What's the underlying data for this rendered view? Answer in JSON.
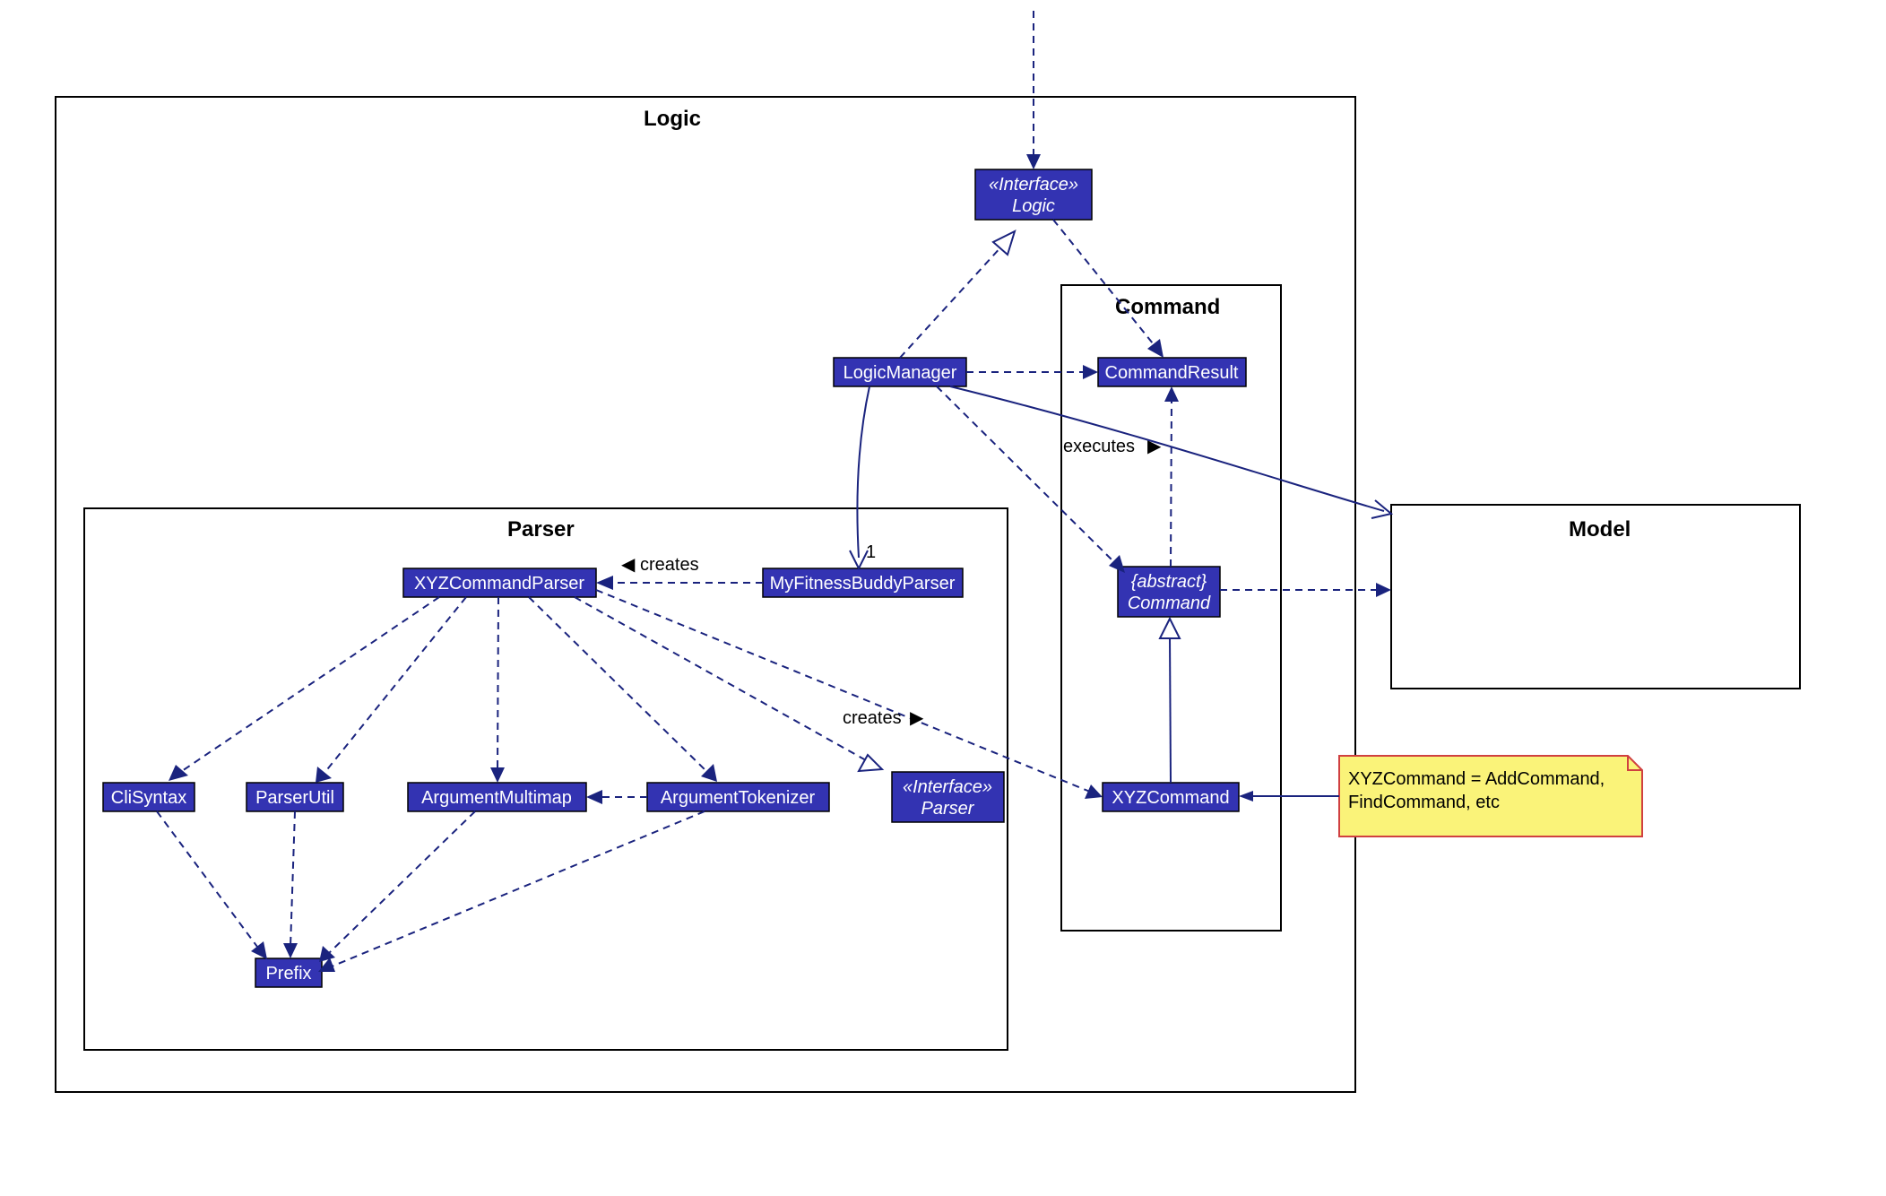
{
  "packages": {
    "logic": "Logic",
    "parser": "Parser",
    "command": "Command",
    "model": "Model"
  },
  "nodes": {
    "logicInterface": {
      "stereotype": "«Interface»",
      "name": "Logic"
    },
    "logicManager": "LogicManager",
    "commandResult": "CommandResult",
    "abstractCommand": {
      "stereotype": "{abstract}",
      "name": "Command"
    },
    "xyzCommand": "XYZCommand",
    "xyzCommandParser": "XYZCommandParser",
    "myFitnessBuddyParser": "MyFitnessBuddyParser",
    "cliSyntax": "CliSyntax",
    "parserUtil": "ParserUtil",
    "argumentMultimap": "ArgumentMultimap",
    "argumentTokenizer": "ArgumentTokenizer",
    "parserInterface": {
      "stereotype": "«Interface»",
      "name": "Parser"
    },
    "prefix": "Prefix"
  },
  "labels": {
    "creates1": "creates",
    "creates2": "creates",
    "executes": "executes",
    "triBlack1": "◀",
    "triBlack2": "▶",
    "triBlack3": "▶",
    "mult1": "1"
  },
  "note": {
    "line1": "XYZCommand = AddCommand,",
    "line2": "FindCommand, etc"
  },
  "colors": {
    "node": "#3333b2",
    "edge": "#1a237e",
    "noteFill": "#faf379",
    "noteStroke": "#d04040"
  }
}
